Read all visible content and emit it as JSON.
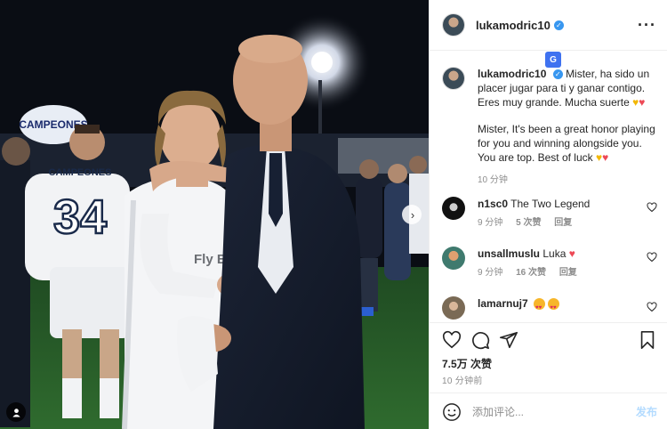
{
  "post": {
    "username": "lukamodric10",
    "verified": true
  },
  "caption": {
    "username": "lukamodric10",
    "spanish": "Mister, ha sido un placer jugar para ti y ganar contigo. Eres muy grande. Mucha suerte",
    "english": "Mister, It's been a great honor playing for you and winning alongside you. You are top. Best of luck",
    "time": "10 分钟"
  },
  "comments": [
    {
      "username": "n1sc0",
      "text": "The Two Legend",
      "time": "9 分钟",
      "likes": "5 次赞",
      "reply": "回复"
    },
    {
      "username": "unsallmuslu",
      "text": "Luka",
      "time": "9 分钟",
      "likes": "16 次赞",
      "reply": "回复"
    },
    {
      "username": "lamarnuj7",
      "text": ""
    }
  ],
  "stats": {
    "likes": "7.5万 次赞",
    "posted": "10 分钟前"
  },
  "composer": {
    "placeholder": "添加评论...",
    "post_label": "发布"
  },
  "photo": {
    "shirt_text": "CAMPEONES",
    "shirt_number": "34",
    "sponsor_text": "Fly Emirates",
    "banner_text": "CAMPEONES"
  },
  "icons": {
    "more": "more-options-icon",
    "translate": "translate-icon",
    "like": "heart-icon",
    "comment": "comment-icon",
    "share": "share-icon",
    "save": "bookmark-icon",
    "emoji": "emoji-icon"
  },
  "colors": {
    "accent": "#3897f0",
    "like_red": "#ed4956",
    "post_disabled": "#b3dbff",
    "muted": "#8e8e8e"
  }
}
